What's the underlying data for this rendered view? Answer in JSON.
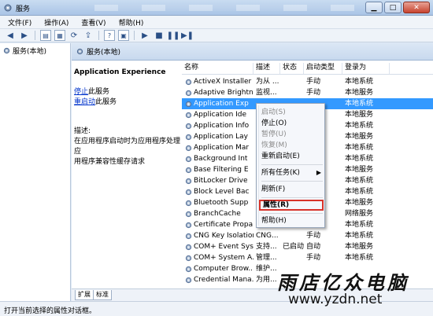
{
  "window": {
    "title": "服务"
  },
  "menu": [
    "文件(F)",
    "操作(A)",
    "查看(V)",
    "帮助(H)"
  ],
  "tree": {
    "root": "服务(本地)"
  },
  "pane_header": "服务(本地)",
  "detail": {
    "service_name": "Application Experience",
    "stop_link": "停止",
    "stop_suffix": "此服务",
    "restart_link": "重启动",
    "restart_suffix": "此服务",
    "desc_label": "描述:",
    "desc_line1": "在应用程序启动时为应用程序处理应",
    "desc_line2": "用程序兼容性缓存请求"
  },
  "columns": [
    "名称",
    "描述",
    "状态",
    "启动类型",
    "登录为"
  ],
  "rows": [
    {
      "name": "ActiveX Installer ...",
      "desc": "为从 ...",
      "status": "",
      "startup": "手动",
      "logon": "本地系统"
    },
    {
      "name": "Adaptive Brightn...",
      "desc": "监视...",
      "status": "",
      "startup": "手动",
      "logon": "本地服务"
    },
    {
      "name": "Application Exp",
      "desc": "",
      "status": "",
      "startup": "",
      "logon": "本地系统"
    },
    {
      "name": "Application Ide",
      "desc": "",
      "status": "",
      "startup": "",
      "logon": "本地服务"
    },
    {
      "name": "Application Info",
      "desc": "",
      "status": "",
      "startup": "",
      "logon": "本地系统"
    },
    {
      "name": "Application Lay",
      "desc": "",
      "status": "",
      "startup": "",
      "logon": "本地服务"
    },
    {
      "name": "Application Mar",
      "desc": "",
      "status": "",
      "startup": "",
      "logon": "本地系统"
    },
    {
      "name": "Background Int",
      "desc": "",
      "status": "",
      "startup": "",
      "logon": "本地系统"
    },
    {
      "name": "Base Filtering E",
      "desc": "",
      "status": "",
      "startup": "",
      "logon": "本地服务"
    },
    {
      "name": "BitLocker Drive",
      "desc": "",
      "status": "",
      "startup": "",
      "logon": "本地系统"
    },
    {
      "name": "Block Level Bac",
      "desc": "",
      "status": "",
      "startup": "",
      "logon": "本地系统"
    },
    {
      "name": "Bluetooth Supp",
      "desc": "",
      "status": "",
      "startup": "",
      "logon": "本地服务"
    },
    {
      "name": "BranchCache",
      "desc": "",
      "status": "",
      "startup": "",
      "logon": "网络服务"
    },
    {
      "name": "Certificate Propa",
      "desc": "",
      "status": "",
      "startup": "",
      "logon": "本地系统"
    },
    {
      "name": "CNG Key Isolation",
      "desc": "CNG...",
      "status": "",
      "startup": "手动",
      "logon": "本地系统"
    },
    {
      "name": "COM+ Event Sys...",
      "desc": "支持...",
      "status": "已启动",
      "startup": "自动",
      "logon": "本地服务"
    },
    {
      "name": "COM+ System A...",
      "desc": "管理...",
      "status": "",
      "startup": "手动",
      "logon": "本地系统"
    },
    {
      "name": "Computer Brow...",
      "desc": "维护...",
      "status": "",
      "startup": "",
      "logon": ""
    },
    {
      "name": "Credential Mana...",
      "desc": "为用...",
      "status": "",
      "startup": "",
      "logon": ""
    }
  ],
  "context_menu": {
    "start": "启动(S)",
    "stop": "停止(O)",
    "pause": "暂停(U)",
    "resume": "恢复(M)",
    "restart": "重新启动(E)",
    "all_tasks": "所有任务(K)",
    "refresh": "刷新(F)",
    "properties": "属性(R)",
    "help": "帮助(H)"
  },
  "tabs": [
    "扩展",
    "标准"
  ],
  "status_text": "打开当前选择的属性对话框。",
  "watermark": {
    "cn": "雨店亿众电脑",
    "url": "www.yzdn.net"
  },
  "colors": {
    "selection": "#3399ff",
    "highlight_box": "#d8332a",
    "link": "#0033cc"
  }
}
